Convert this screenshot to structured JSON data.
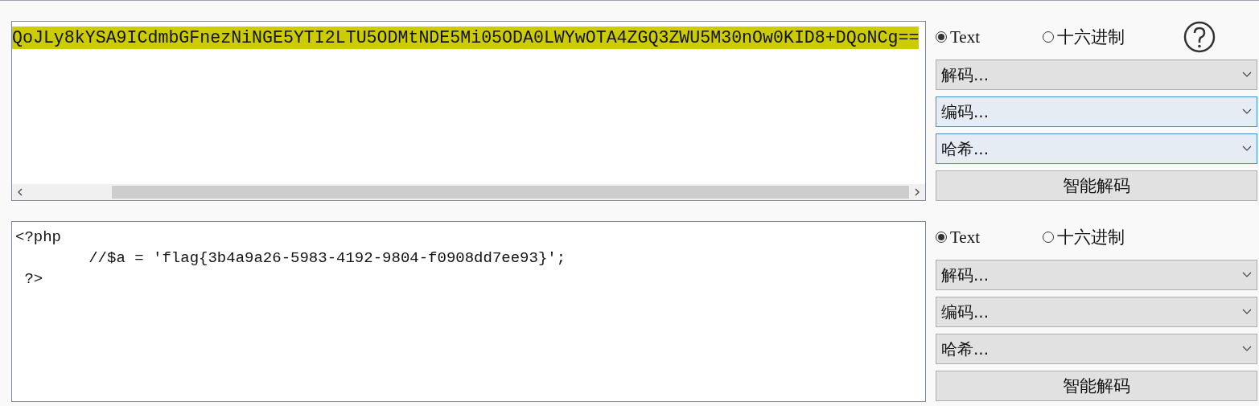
{
  "panels": [
    {
      "text": {
        "lines": [
          "QoJLy8kYSA9ICdmbGFnezNiNGE5YTI2LTU5ODMtNDE5Mi05ODA0LWYwOTA4ZGQ3ZWU5M30nOw0KID8+DQoNCg=="
        ],
        "selected": true
      },
      "scrollbar": true,
      "modes": [
        {
          "label": "Text",
          "selected": true
        },
        {
          "label": "十六进制",
          "selected": false
        }
      ],
      "help": true,
      "dropdowns": [
        {
          "label": "解码...",
          "highlighted": false
        },
        {
          "label": "编码...",
          "highlighted": true
        },
        {
          "label": "哈希...",
          "highlighted": true
        }
      ],
      "button": "智能解码"
    },
    {
      "text": {
        "lines": [
          "<?php",
          "\t//$a = 'flag{3b4a9a26-5983-4192-9804-f0908dd7ee93}';",
          " ?>"
        ],
        "selected": false
      },
      "scrollbar": false,
      "modes": [
        {
          "label": "Text",
          "selected": true
        },
        {
          "label": "十六进制",
          "selected": false
        }
      ],
      "help": false,
      "dropdowns": [
        {
          "label": "解码...",
          "highlighted": false
        },
        {
          "label": "编码...",
          "highlighted": false
        },
        {
          "label": "哈希...",
          "highlighted": false
        }
      ],
      "button": "智能解码"
    }
  ]
}
